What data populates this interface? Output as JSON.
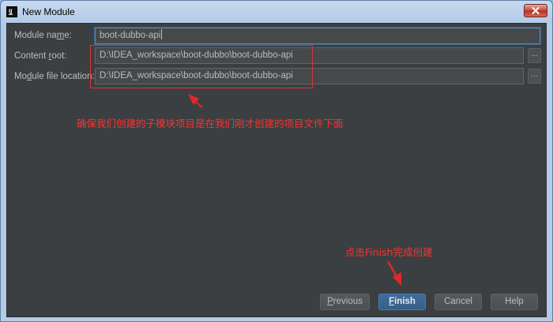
{
  "window": {
    "title": "New Module"
  },
  "form": {
    "module_name": {
      "label_pre": "Module na",
      "label_mnemonic": "m",
      "label_post": "e:",
      "value": "boot-dubbo-api"
    },
    "content_root": {
      "label_pre": "Content ",
      "label_mnemonic": "r",
      "label_post": "oot:",
      "value": "D:\\IDEA_workspace\\boot-dubbo\\boot-dubbo-api",
      "browse": "..."
    },
    "module_file_location": {
      "label_pre": "Mo",
      "label_mnemonic": "d",
      "label_post": "ule file location:",
      "value": "D:\\IDEA_workspace\\boot-dubbo\\boot-dubbo-api",
      "browse": "..."
    }
  },
  "annotations": {
    "paths_note": "确保我们创建的子模块项目是在我们刚才创建的项目文件下面",
    "finish_note": "点击Finish完成创建",
    "color": "#ff3030"
  },
  "buttons": {
    "previous": {
      "mnemonic": "P",
      "rest": "revious"
    },
    "finish": {
      "mnemonic": "F",
      "rest": "inish"
    },
    "cancel": "Cancel",
    "help": "Help"
  },
  "colors": {
    "background": "#3c3f41",
    "text": "#bbbbbb",
    "primary_button": "#365f89"
  }
}
